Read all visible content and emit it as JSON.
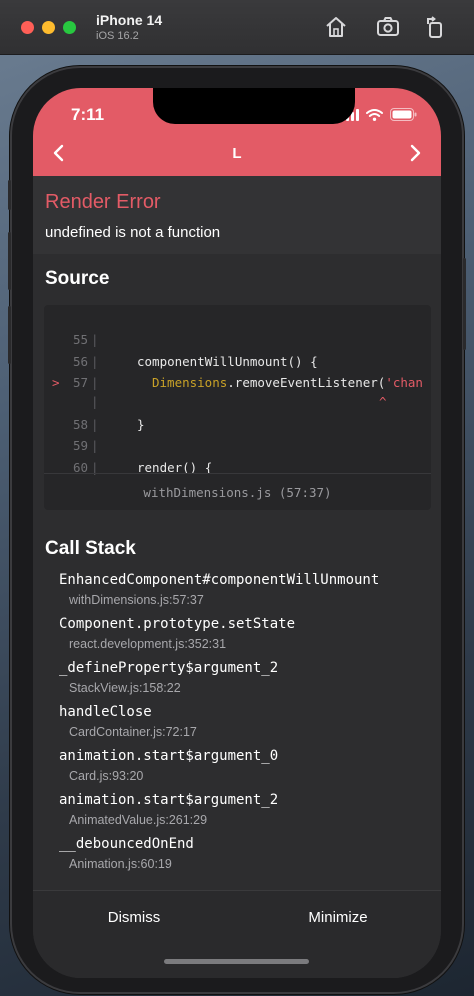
{
  "simulator": {
    "device_name": "iPhone 14",
    "os_version": "iOS 16.2",
    "icons": [
      "home-icon",
      "screenshot-icon",
      "rotate-icon"
    ]
  },
  "status_bar": {
    "time": "7:11",
    "icons": [
      "signal-icon",
      "wifi-icon",
      "battery-icon"
    ]
  },
  "nav": {
    "title": "L",
    "back_icon": "chevron-left-icon",
    "forward_icon": "chevron-right-icon"
  },
  "error": {
    "title": "Render Error",
    "message": "undefined is not a function"
  },
  "source": {
    "title": "Source",
    "lines": [
      {
        "marker": "",
        "num": "55",
        "bar": "|",
        "code": ""
      },
      {
        "marker": "",
        "num": "56",
        "bar": "|",
        "code": "componentWillUnmount() {"
      },
      {
        "marker": ">",
        "num": "57",
        "bar": "|",
        "code": "Dimensions.removeEventListener('chan"
      },
      {
        "marker": "",
        "num": "",
        "bar": "|",
        "code": "^"
      },
      {
        "marker": "",
        "num": "58",
        "bar": "|",
        "code": "}"
      },
      {
        "marker": "",
        "num": "59",
        "bar": "|",
        "code": ""
      },
      {
        "marker": "",
        "num": "60",
        "bar": "|",
        "code": "render() {"
      }
    ],
    "location": "withDimensions.js (57:37)"
  },
  "call_stack": {
    "title": "Call Stack",
    "items": [
      {
        "method": "EnhancedComponent#componentWillUnmount",
        "file": "withDimensions.js:57:37"
      },
      {
        "method": "Component.prototype.setState",
        "file": "react.development.js:352:31"
      },
      {
        "method": "_defineProperty$argument_2",
        "file": "StackView.js:158:22"
      },
      {
        "method": "handleClose",
        "file": "CardContainer.js:72:17"
      },
      {
        "method": "animation.start$argument_0",
        "file": "Card.js:93:20"
      },
      {
        "method": "animation.start$argument_2",
        "file": "AnimatedValue.js:261:29"
      },
      {
        "method": "__debouncedOnEnd",
        "file": "Animation.js:60:19"
      }
    ]
  },
  "footer": {
    "dismiss_label": "Dismiss",
    "minimize_label": "Minimize"
  },
  "colors": {
    "accent": "#e35b66",
    "background": "#2d2d2f",
    "code_background": "#262628",
    "highlight": "#c9a227"
  }
}
